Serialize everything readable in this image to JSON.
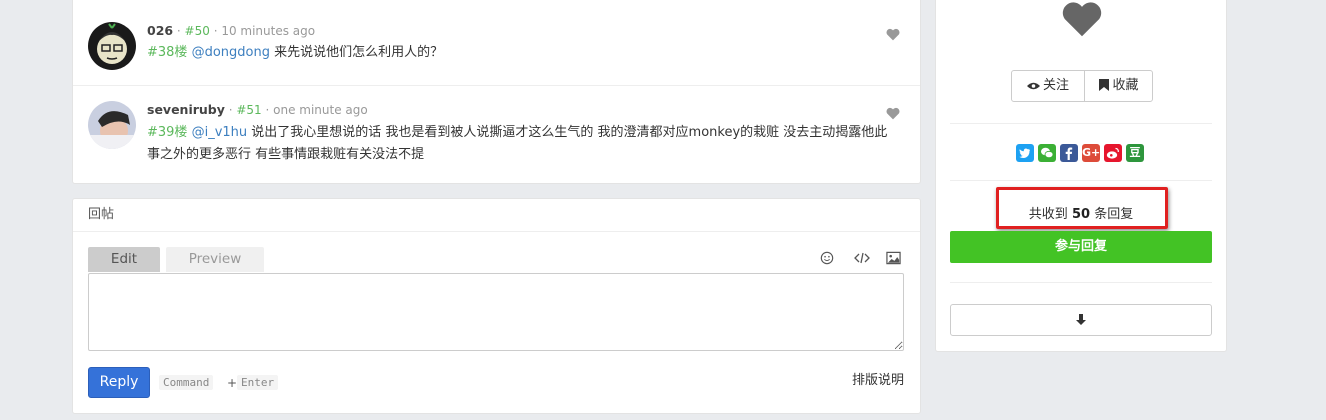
{
  "replies": [
    {
      "user": "026",
      "floor": "#50",
      "time": "10 minutes ago",
      "floor_ref": "#38楼",
      "mention": "@dongdong",
      "text": "来先说说他们怎么利用人的？"
    },
    {
      "user": "seveniruby",
      "floor": "#51",
      "time": "one minute ago",
      "floor_ref": "#39楼",
      "mention": "@i_v1hu",
      "text": "说出了我心里想说的话 我也是看到被人说撕逼才这么生气的 我的澄清都对应monkey的栽赃 没去主动揭露他此事之外的更多恶行 有些事情跟栽赃有关没法不提"
    }
  ],
  "composer": {
    "title": "回帖",
    "tab_edit": "Edit",
    "tab_preview": "Preview",
    "reply_button": "Reply",
    "shortcut_key1": "Command",
    "shortcut_plus": "+",
    "shortcut_key2": "Enter",
    "guide_link": "排版说明"
  },
  "sidebar": {
    "follow_label": "关注",
    "favorite_label": "收藏",
    "reply_count_prefix": "共收到",
    "reply_count": "50",
    "reply_count_suffix": "条回复",
    "join_button": "参与回复",
    "share_icons": [
      "twitter-icon",
      "wechat-icon",
      "facebook-icon",
      "google-plus-icon",
      "weibo-icon",
      "douban-icon"
    ],
    "douban_glyph": "豆",
    "googleplus_glyph": "G+"
  },
  "colors": {
    "accent_blue": "#3572d9",
    "join_green": "#43c325",
    "floor_green": "#5cb85c",
    "mention_blue": "#3d7fbf",
    "highlight_red": "#e02020"
  }
}
